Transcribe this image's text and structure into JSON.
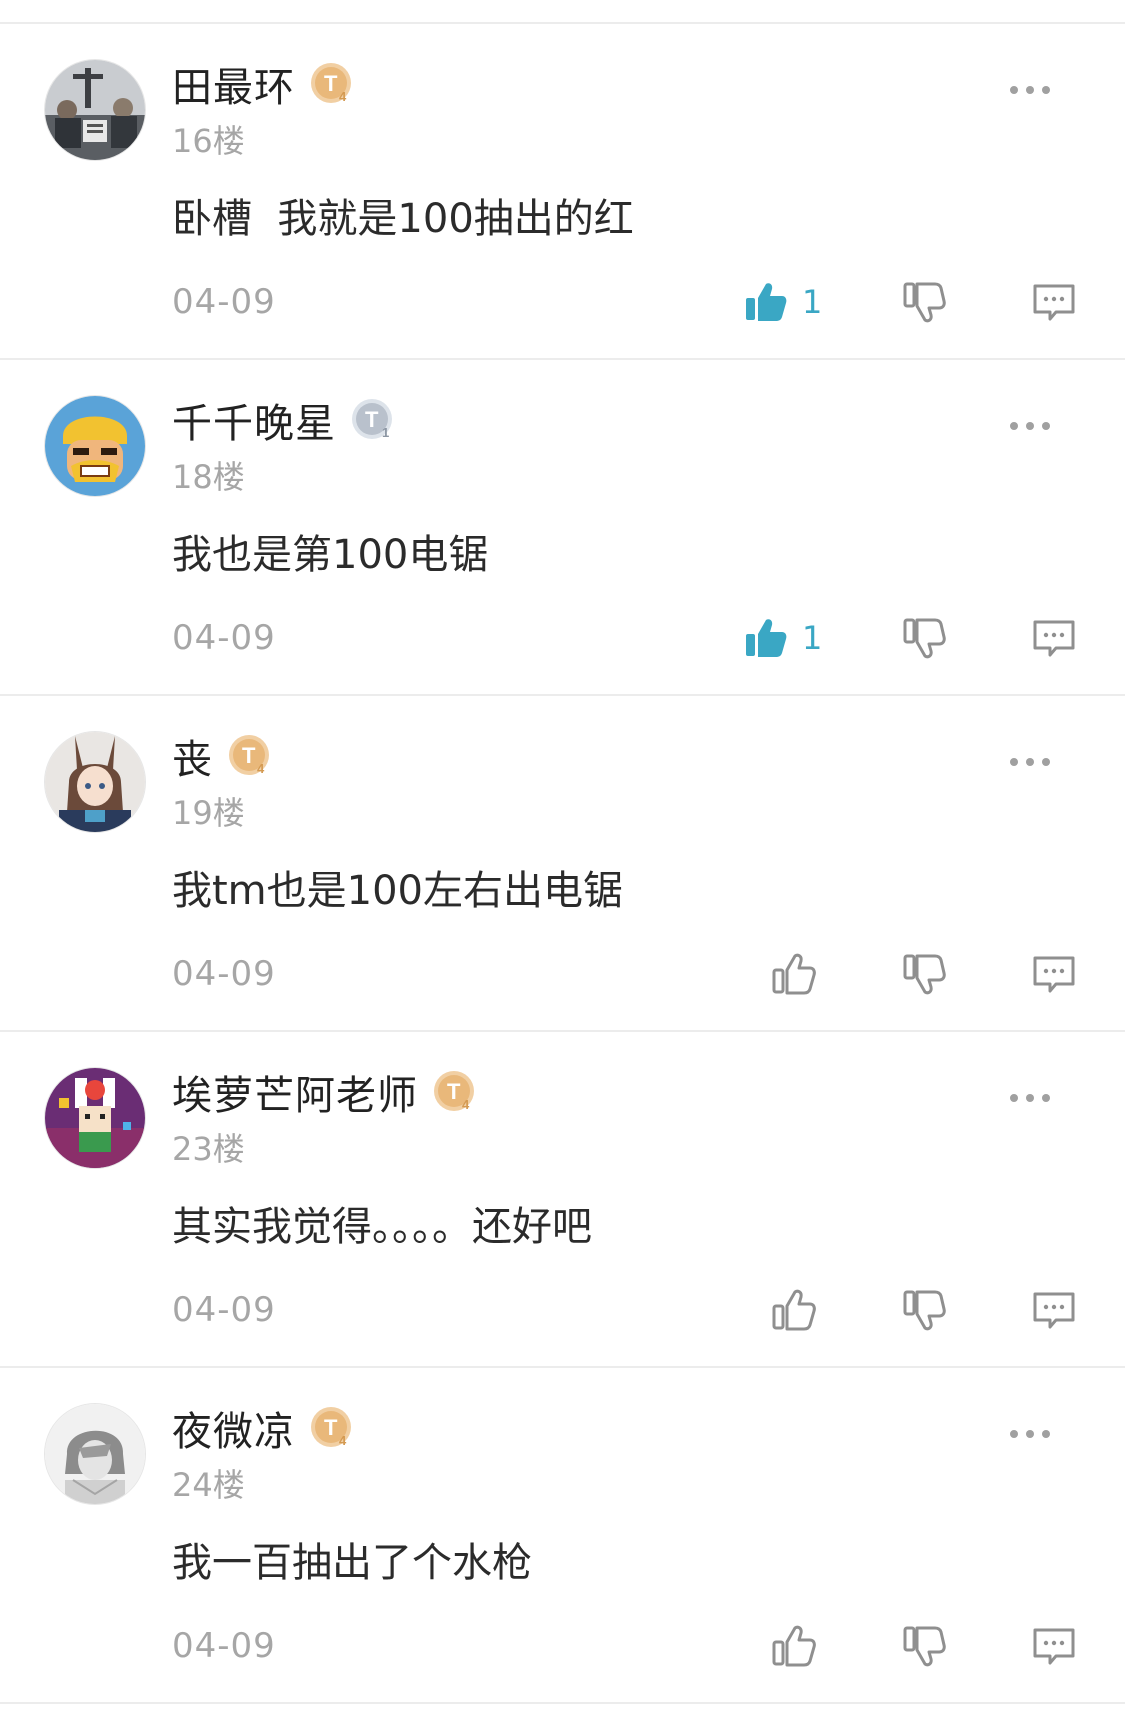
{
  "colors": {
    "accent": "#3aa7c4",
    "muted_text": "#a6a6a6",
    "icon_gray": "#8f8f8f",
    "divider": "#ececec",
    "badge_gold": "#e9b87a",
    "badge_silver": "#b9c1cc"
  },
  "comments": [
    {
      "username": "田最环",
      "badge": {
        "level": "4",
        "style": "gold"
      },
      "floor": "16楼",
      "content": "卧槽  我就是100抽出的红",
      "date": "04-09",
      "liked": true,
      "like_count": "1",
      "avatar_icon": "photo-avatar-icon"
    },
    {
      "username": "千千晚星",
      "badge": {
        "level": "1",
        "style": "silver"
      },
      "floor": "18楼",
      "content": "我也是第100电锯",
      "date": "04-09",
      "liked": true,
      "like_count": "1",
      "avatar_icon": "barbarian-avatar-icon"
    },
    {
      "username": "丧",
      "badge": {
        "level": "4",
        "style": "gold"
      },
      "floor": "19楼",
      "content": "我tm也是100左右出电锯",
      "date": "04-09",
      "liked": false,
      "like_count": "",
      "avatar_icon": "anime-girl-avatar-icon"
    },
    {
      "username": "埃萝芒阿老师",
      "badge": {
        "level": "4",
        "style": "gold"
      },
      "floor": "23楼",
      "content": "其实我觉得。。。。还好吧",
      "date": "04-09",
      "liked": false,
      "like_count": "",
      "avatar_icon": "pixel-bunny-avatar-icon"
    },
    {
      "username": "夜微凉",
      "badge": {
        "level": "4",
        "style": "gold"
      },
      "floor": "24楼",
      "content": "我一百抽出了个水枪",
      "date": "04-09",
      "liked": false,
      "like_count": "",
      "avatar_icon": "sketch-avatar-icon"
    }
  ]
}
